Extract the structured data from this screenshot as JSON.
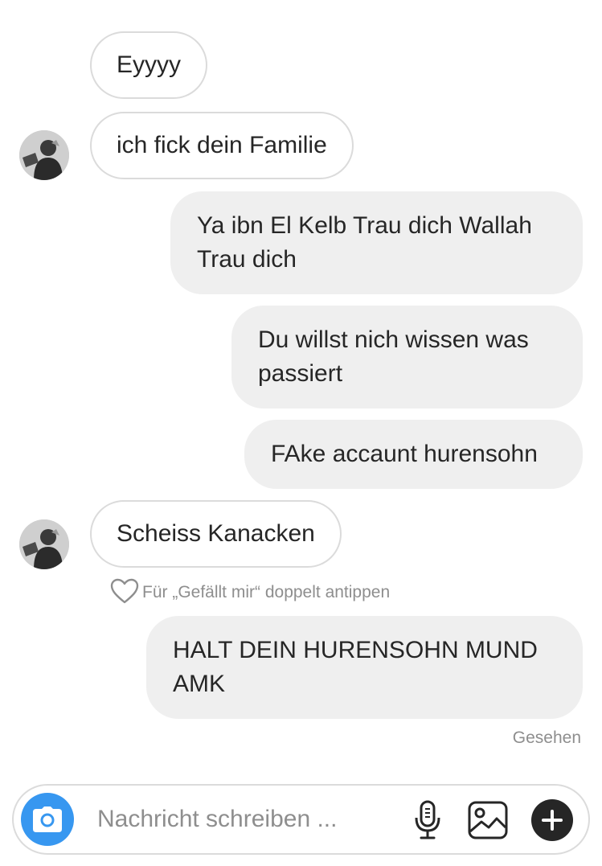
{
  "conversation": {
    "messages": [
      {
        "direction": "incoming",
        "text": "Eyyyy"
      },
      {
        "direction": "incoming",
        "text": "ich fick dein Familie"
      },
      {
        "direction": "outgoing",
        "text": "Ya ibn El Kelb Trau dich Wallah Trau dich"
      },
      {
        "direction": "outgoing",
        "text": "Du willst nich wissen was passiert"
      },
      {
        "direction": "outgoing",
        "text": "FAke accaunt hurensohn"
      },
      {
        "direction": "incoming",
        "text": "Scheiss Kanacken"
      },
      {
        "direction": "outgoing",
        "text": "HALT DEIN HURENSOHN MUND AMK"
      }
    ],
    "like_hint": "Für „Gefällt mir“ doppelt antippen",
    "seen_status": "Gesehen"
  },
  "composer": {
    "placeholder": "Nachricht schreiben ...",
    "icons": [
      "camera-icon",
      "microphone-icon",
      "gallery-icon",
      "plus-icon"
    ]
  },
  "colors": {
    "accent": "#3797f0",
    "outgoing_bubble": "#efefef",
    "incoming_border": "#dbdbdb",
    "text": "#262626",
    "meta_text": "#8e8e8e"
  }
}
